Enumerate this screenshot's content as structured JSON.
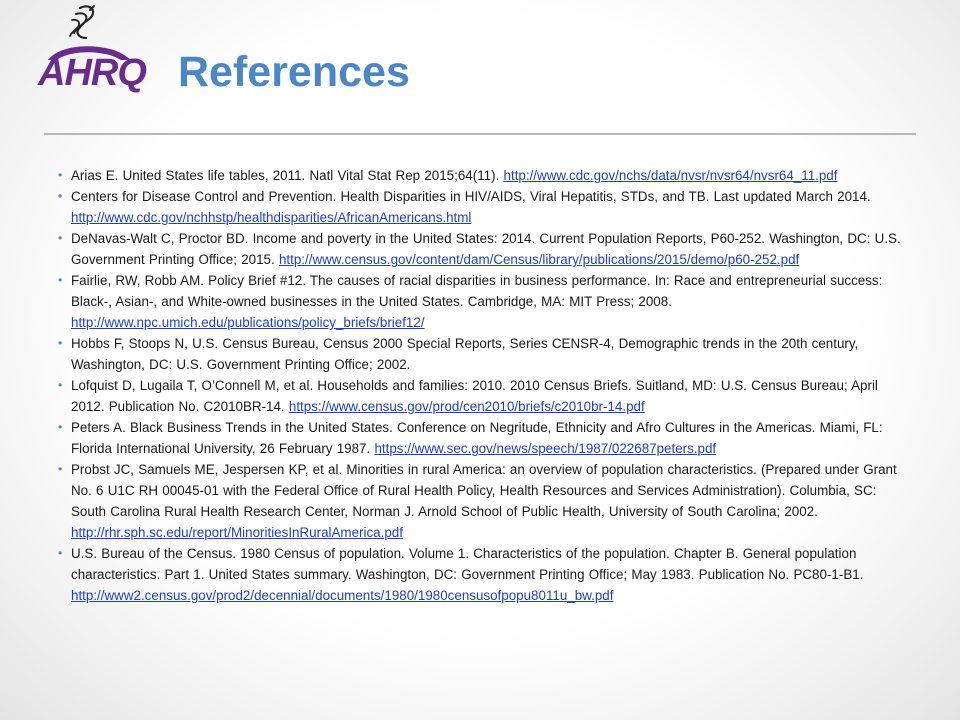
{
  "header": {
    "logo_text": "AHRQ",
    "logo_icon": "hhs-eagle-icon",
    "title": "References"
  },
  "colors": {
    "title": "#4a87c4",
    "logo": "#6a2c8c",
    "link": "#1f3fbf",
    "rule": "#b8b8b8"
  },
  "references": [
    {
      "text": "Arias E. United States life tables, 2011. Natl Vital Stat Rep 2015;64(11).",
      "url": "http://www.cdc.gov/nchs/data/nvsr/nvsr64/nvsr64_11.pdf"
    },
    {
      "text": "Centers for Disease Control and Prevention. Health Disparities in HIV/AIDS, Viral Hepatitis, STDs, and TB. Last updated March 2014.",
      "url": "http://www.cdc.gov/nchhstp/healthdisparities/AfricanAmericans.html"
    },
    {
      "text": "DeNavas-Walt C, Proctor BD. Income and poverty in the United States: 2014. Current Population Reports, P60-252. Washington, DC: U.S. Government Printing Office; 2015.",
      "url": "http://www.census.gov/content/dam/Census/library/publications/2015/demo/p60-252.pdf"
    },
    {
      "text": "Fairlie, RW, Robb AM. Policy Brief #12. The causes of racial disparities in business performance. In: Race and entrepreneurial success: Black-, Asian-, and White-owned businesses in the United States. Cambridge, MA: MIT Press; 2008.",
      "url": "http://www.npc.umich.edu/publications/policy_briefs/brief12/"
    },
    {
      "text": "Hobbs F, Stoops N, U.S. Census Bureau, Census 2000 Special Reports, Series CENSR-4, Demographic trends in the 20th century, Washington, DC: U.S. Government Printing Office; 2002.",
      "url": ""
    },
    {
      "text": "Lofquist D, Lugaila T, O’Connell M, et al. Households and families: 2010. 2010 Census Briefs. Suitland, MD: U.S. Census Bureau; April 2012. Publication No. C2010BR-14.",
      "url": "https://www.census.gov/prod/cen2010/briefs/c2010br-14.pdf"
    },
    {
      "text": "Peters A. Black Business Trends in the United States. Conference on Negritude, Ethnicity and Afro Cultures in the Americas. Miami, FL: Florida International University, 26 February 1987.",
      "url": "https://www.sec.gov/news/speech/1987/022687peters.pdf"
    },
    {
      "text": "Probst JC, Samuels ME, Jespersen KP, et al. Minorities in rural America: an overview of population characteristics. (Prepared under Grant No. 6 U1C RH 00045-01 with the Federal Office of Rural Health Policy, Health Resources and Services Administration).  Columbia, SC: South Carolina Rural Health Research Center, Norman J. Arnold School of Public Health, University of South Carolina; 2002.",
      "url": "http://rhr.sph.sc.edu/report/MinoritiesInRuralAmerica.pdf"
    },
    {
      "text": "U.S. Bureau of the Census. 1980 Census of population. Volume 1. Characteristics of the population. Chapter B. General population characteristics. Part 1. United States summary. Washington, DC: Government Printing Office; May 1983. Publication No. PC80-1-B1.",
      "url": "http://www2.census.gov/prod2/decennial/documents/1980/1980censusofpopu8011u_bw.pdf"
    }
  ]
}
